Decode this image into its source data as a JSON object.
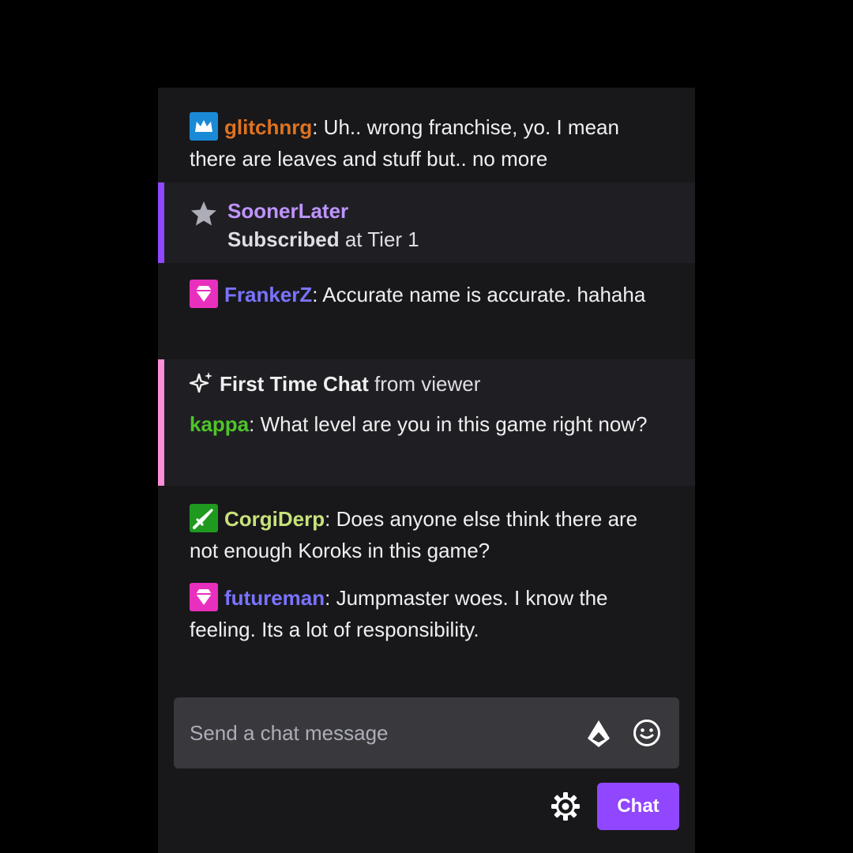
{
  "messages": [
    {
      "user": "glitchnrg",
      "color": "#e0731f",
      "badge": "crown-icon",
      "text": ": Uh.. wrong franchise, yo. I mean there are leaves and stuff but.. no more"
    },
    {
      "user": "FrankerZ",
      "color": "#7a73ff",
      "badge": "diamond-icon",
      "text": ": Accurate name is accurate. hahaha"
    },
    {
      "user": "CorgiDerp",
      "color": "#c8e27a",
      "badge": "sword-icon",
      "text": ": Does anyone else think there are not enough Koroks in this game?"
    },
    {
      "user": "futureman",
      "color": "#7a73ff",
      "badge": "diamond-icon",
      "text": ": Jumpmaster woes. I know the feeling. Its a lot of responsibility."
    }
  ],
  "subscription": {
    "user": "SoonerLater",
    "action": "Subscribed",
    "detail": " at Tier 1",
    "accent": "#9147ff",
    "icon": "star-icon"
  },
  "first_time_chat": {
    "title": "First Time Chat",
    "suffix": " from viewer",
    "icon": "sparkle-icon",
    "accent": "#ff8ed9",
    "user": "kappa",
    "user_color": "#4fc42a",
    "text": ": What level are you in this game right now?"
  },
  "input": {
    "placeholder": "Send a chat message",
    "bits_icon": "bits-icon",
    "emote_icon": "emote-icon"
  },
  "footer": {
    "settings_icon": "gear-icon",
    "chat_label": "Chat",
    "accent": "#9147ff"
  }
}
